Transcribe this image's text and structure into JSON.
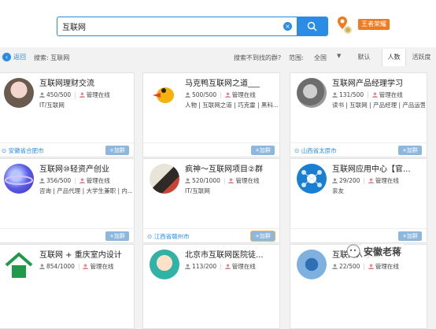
{
  "search": {
    "value": "互联网"
  },
  "header": {
    "vip_badge": "王者荣耀"
  },
  "filter": {
    "back_label": "返回",
    "search_label": "搜索: 互联网",
    "not_found": "搜索不到找的群?",
    "range_label": "范围:",
    "range_value": "全国",
    "sort_tabs": [
      "默认",
      "人数",
      "活跃度"
    ],
    "active_sort": "人数"
  },
  "cards": [
    {
      "name": "互联网理财交流",
      "count": "450/500",
      "status": "管理在线",
      "tags": "IT/互联网",
      "location": "安徽省合肥市",
      "join": "+加群"
    },
    {
      "name": "马克鸭互联网之道___",
      "count": "500/500",
      "status": "管理在线",
      "tags": "人物 | 互联网之道 | 巧克雷 | 黑科...",
      "location": "",
      "join": "+加群"
    },
    {
      "name": "互联网产品经理学习",
      "count": "131/500",
      "status": "管理在线",
      "tags": "读书 | 互联网 | 产品经理 | 产品运营",
      "location": "山西省太原市",
      "join": "+加群"
    },
    {
      "name": "互联网⑩轻资产创业",
      "count": "356/500",
      "status": "管理在线",
      "tags": "咨询 | 产品代理 | 大学生兼职 | 内...",
      "location": "",
      "join": "+加群"
    },
    {
      "name": "疯神～互联网项目②群",
      "count": "520/1000",
      "status": "管理在线",
      "tags": "IT/互联网",
      "location": "江西省赣州市",
      "join": "+加群"
    },
    {
      "name": "互联网应用中心【官...",
      "count": "29/200",
      "status": "管理在线",
      "tags": "亲友",
      "location": "",
      "join": "+加群"
    },
    {
      "name": "互联网 + 重庆室内设计",
      "count": "854/1000",
      "status": "管理在线",
      "tags": "",
      "location": "",
      "join": ""
    },
    {
      "name": "北京市互联网医院徒...",
      "count": "113/200",
      "status": "管理在线",
      "tags": "",
      "location": "",
      "join": ""
    },
    {
      "name": "互联网人才...",
      "count": "22/500",
      "status": "管理在线",
      "tags": "",
      "location": "",
      "join": ""
    }
  ],
  "watermark": "安徽老蒋",
  "colors": {
    "accent": "#2a8ce5",
    "badge": "#f27a1e",
    "join_btn": "#8db7dc"
  }
}
